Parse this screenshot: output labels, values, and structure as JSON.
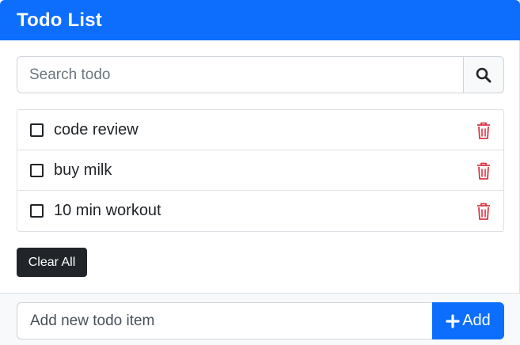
{
  "header": {
    "title": "Todo List"
  },
  "search": {
    "placeholder": "Search todo",
    "button_icon": "search-icon"
  },
  "todos": [
    {
      "text": "code review",
      "checked": false
    },
    {
      "text": "buy milk",
      "checked": false
    },
    {
      "text": "10 min workout",
      "checked": false
    }
  ],
  "actions": {
    "clear_all_label": "Clear All"
  },
  "footer": {
    "add_placeholder": "Add new todo item",
    "add_label": "Add",
    "add_icon": "plus-icon"
  },
  "colors": {
    "primary": "#0d6efd",
    "danger": "#dc3545",
    "dark": "#212529",
    "light": "#f8f9fa"
  }
}
